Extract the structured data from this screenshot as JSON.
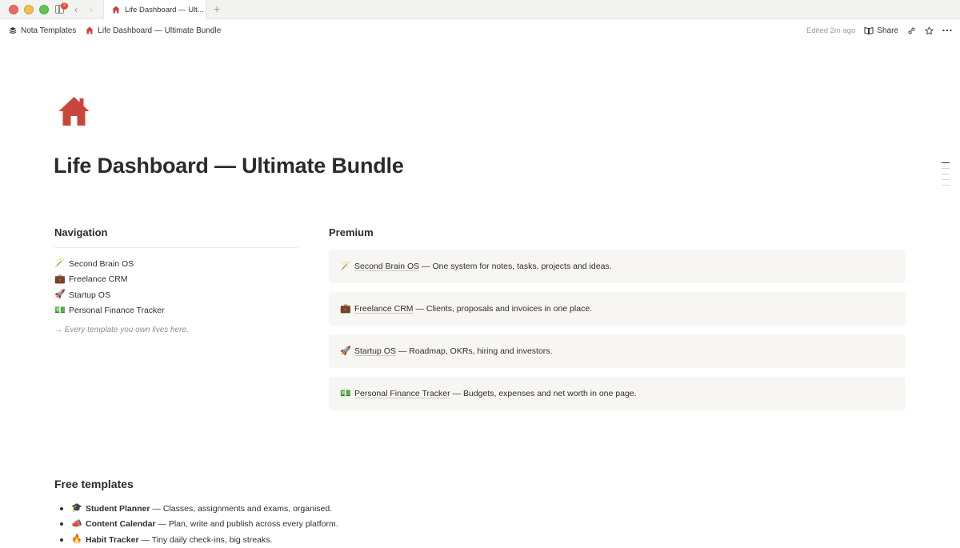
{
  "window": {
    "tab_title": "Life Dashboard — Ult...",
    "notification_count": "2",
    "back_icon": "‹",
    "forward_icon": "›",
    "new_tab_icon": "+"
  },
  "breadcrumb": {
    "workspace": "Nota Templates",
    "page": "Life Dashboard — Ultimate Bundle"
  },
  "topbar": {
    "edited": "Edited 2m ago",
    "share_label": "Share"
  },
  "page": {
    "title": "Life Dashboard — Ultimate Bundle",
    "icon_color": "#c8473c"
  },
  "navigation": {
    "heading": "Navigation",
    "items": [
      {
        "emoji": "🪄",
        "label": "Second Brain OS"
      },
      {
        "emoji": "💼",
        "label": "Freelance CRM"
      },
      {
        "emoji": "🚀",
        "label": "Startup OS"
      },
      {
        "emoji": "💵",
        "label": "Personal Finance Tracker"
      }
    ],
    "note": "→ Every template you own lives here."
  },
  "premium": {
    "heading": "Premium",
    "cards": [
      {
        "emoji": "🪄",
        "name": "Second Brain OS",
        "desc": " — One system for notes, tasks, projects and ideas."
      },
      {
        "emoji": "💼",
        "name": "Freelance CRM",
        "desc": " — Clients, proposals and invoices in one place."
      },
      {
        "emoji": "🚀",
        "name": "Startup OS",
        "desc": " — Roadmap, OKRs, hiring and investors."
      },
      {
        "emoji": "💵",
        "name": "Personal Finance Tracker",
        "desc": " — Budgets, expenses and net worth in one page."
      }
    ]
  },
  "free": {
    "heading": "Free templates",
    "items": [
      {
        "emoji": "🎓",
        "name": "Student Planner",
        "desc": " — Classes, assignments and exams, organised."
      },
      {
        "emoji": "📣",
        "name": "Content Calendar",
        "desc": " — Plan, write and publish across every platform."
      },
      {
        "emoji": "🔥",
        "name": "Habit Tracker",
        "desc": " — Tiny daily check-ins, big streaks."
      }
    ]
  }
}
